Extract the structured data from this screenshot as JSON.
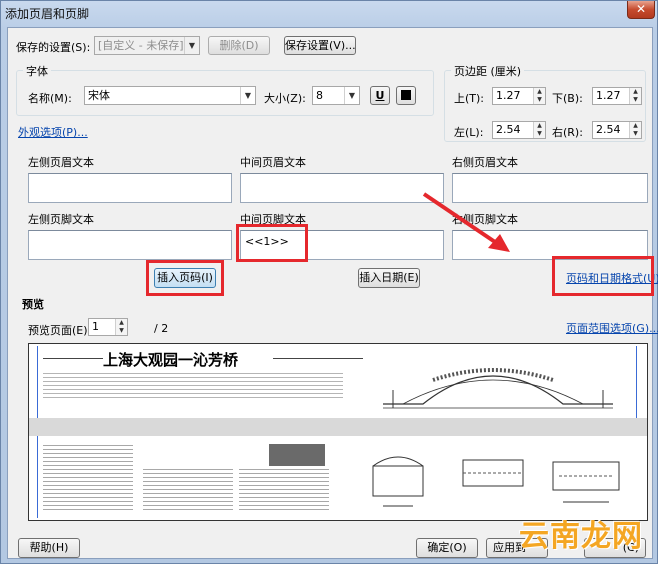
{
  "window": {
    "title": "添加页眉和页脚",
    "close_glyph": "✕"
  },
  "saved_settings": {
    "label": "保存的设置(S):",
    "value": "[自定义 - 未保存]",
    "delete_button": "删除(D)",
    "save_button": "保存设置(V)..."
  },
  "font": {
    "group_title": "字体",
    "name_label": "名称(M):",
    "name_value": "宋体",
    "size_label": "大小(Z):",
    "size_value": "8",
    "underline_glyph": "U"
  },
  "margins": {
    "group_title": "页边距 (厘米)",
    "top_label": "上(T):",
    "top_value": "1.27",
    "bottom_label": "下(B):",
    "bottom_value": "1.27",
    "left_label": "左(L):",
    "left_value": "2.54",
    "right_label": "右(R):",
    "right_value": "2.54"
  },
  "appearance_link": "外观选项(P)...",
  "header": {
    "left_label": "左侧页眉文本",
    "center_label": "中间页眉文本",
    "right_label": "右侧页眉文本"
  },
  "footer": {
    "left_label": "左侧页脚文本",
    "center_label": "中间页脚文本",
    "center_value": "<<1>>",
    "right_label": "右侧页脚文本"
  },
  "insert_page_button": "插入页码(I)",
  "insert_date_button": "插入日期(E)",
  "page_date_format_link": "页码和日期格式(U)...",
  "preview": {
    "section_title": "预览",
    "page_label": "预览页面(E)",
    "page_value": "1",
    "page_total": "/ 2",
    "range_link": "页面范围选项(G)...",
    "page1_heading": "上海大观园一沁芳桥"
  },
  "buttons": {
    "help": "帮助(H)",
    "ok": "确定(O)",
    "apply": "应用到",
    "cancel": "(C)"
  },
  "watermark": "云南龙网",
  "colors": {
    "highlight_red": "#e5282d",
    "link_blue": "#0645ad",
    "watermark_orange": "#f4a623"
  }
}
